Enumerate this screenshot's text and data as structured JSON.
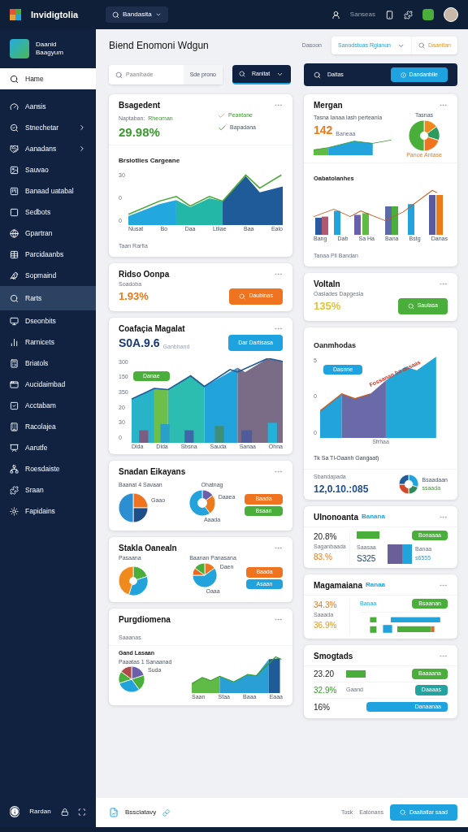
{
  "topbar": {
    "logo_text": "Invidigtolia",
    "search_button": "Bandasita",
    "user_label": "Sanseas"
  },
  "sidebar": {
    "profile": {
      "line1": "Daanid",
      "line2": "Baagyum"
    },
    "items": [
      {
        "label": "Hame",
        "kind": "link",
        "selected": true,
        "highlighted": false
      },
      {
        "label": "Aansis",
        "kind": "link",
        "selected": false,
        "highlighted": false
      },
      {
        "label": "Stnechetar",
        "kind": "group",
        "selected": false,
        "highlighted": false
      },
      {
        "label": "Aanadans",
        "kind": "group",
        "selected": false,
        "highlighted": false
      },
      {
        "label": "Sauvao",
        "kind": "link",
        "selected": false,
        "highlighted": false
      },
      {
        "label": "Banaad uatabal",
        "kind": "link",
        "selected": false,
        "highlighted": false
      },
      {
        "label": "Sedbots",
        "kind": "link",
        "selected": false,
        "highlighted": false
      },
      {
        "label": "Gpartran",
        "kind": "link",
        "selected": false,
        "highlighted": false
      },
      {
        "label": "Parcidaanbs",
        "kind": "link",
        "selected": false,
        "highlighted": false
      },
      {
        "label": "Sopmaind",
        "kind": "link",
        "selected": false,
        "highlighted": false
      },
      {
        "label": "Rarts",
        "kind": "link",
        "selected": false,
        "highlighted": true
      },
      {
        "label": "Dseonbits",
        "kind": "link",
        "selected": false,
        "highlighted": false
      },
      {
        "label": "Rarnicets",
        "kind": "link",
        "selected": false,
        "highlighted": false
      },
      {
        "label": "Briatols",
        "kind": "link",
        "selected": false,
        "highlighted": false
      },
      {
        "label": "Aucidaimbad",
        "kind": "link",
        "selected": false,
        "highlighted": false
      },
      {
        "label": "Acctabam",
        "kind": "link",
        "selected": false,
        "highlighted": false
      },
      {
        "label": "Racolajea",
        "kind": "link",
        "selected": false,
        "highlighted": false
      },
      {
        "label": "Aarutfe",
        "kind": "link",
        "selected": false,
        "highlighted": false
      },
      {
        "label": "Roesdaiste",
        "kind": "link",
        "selected": false,
        "highlighted": false
      },
      {
        "label": "Sraan",
        "kind": "link",
        "selected": false,
        "highlighted": false
      },
      {
        "label": "Fapidains",
        "kind": "link",
        "selected": false,
        "highlighted": false
      }
    ],
    "footer_label": "Rardan"
  },
  "header": {
    "title": "Biend Enomoni Wdgun",
    "filter_label": "Dasoon",
    "select_value": "Sanodstoas Rgianun",
    "action_button": "Daanitan"
  },
  "toolbar": {
    "search_placeholder": "Paanibade",
    "search_button": "Sde prono",
    "dropdown": "Ranitat",
    "panel_label": "Daitas",
    "panel_button": "Dandanbile"
  },
  "cards": {
    "summary": {
      "title": "Bsagedent",
      "label": "Naptaban:",
      "label_value": "Rheoman",
      "value": "29.98%",
      "check_1": "Peantane",
      "check_2": "Bapadana",
      "chart_title": "Brsiotlies Cargeane",
      "yticks": [
        "30",
        "0",
        "0"
      ],
      "xlabels": [
        "Nusat",
        "Bo",
        "Daa",
        "Ltliae",
        "Baa",
        "Ealo"
      ],
      "footer": "Taan Rarfia"
    },
    "margin": {
      "title": "Mergan",
      "caption": "Tasna Ianaa lash perteanla",
      "value": "142",
      "value_note": "Baneaa",
      "pie_label": "Tasnas",
      "pie_note": "Panoe Antase",
      "chart_title": "Oabatolanhes",
      "xlabels": [
        "Bang",
        "Dab",
        "Sa Ha",
        "Bana",
        "Bstg",
        "Danas"
      ],
      "footer": "Tanaa Pll Bandan"
    },
    "ratio": {
      "title": "Ridso Oonpa",
      "caption": "Soadoba",
      "value": "1.93%",
      "button": "Daubinas"
    },
    "volume": {
      "title": "Voltaln",
      "caption": "Oaslades Dapgesia",
      "value": "135%",
      "button": "Saulasa"
    },
    "compare": {
      "title": "Coafaçia Magalat",
      "value": "S0A.9.6",
      "value_note": "Ganbhand",
      "button": "Dar Dartisasa",
      "tag": "Danae",
      "yticks": [
        "300",
        "150",
        "350",
        "20",
        "30",
        "0"
      ],
      "xlabels": [
        "Dlda",
        "Dlda",
        "Sbsna",
        "Sauda",
        "Sanaa",
        "Ohna"
      ]
    },
    "growth": {
      "title": "Oanmhodas",
      "tag": "Dasnne",
      "annotation": "Fossanan ba ansaas",
      "yticks": [
        "5",
        "0",
        "0"
      ],
      "xlabel": "Sfrhaa",
      "footer": "Tk Sa Tl-Oaanh Gangaat)",
      "stat_label": "Sbandapada",
      "stat_value": "12,0.10.:085",
      "donut_label": "Bsaadaan",
      "donut_value": "ssaada"
    },
    "split": {
      "title": "Snadan Eikayans",
      "caption": "Baanat 4 Savaan",
      "pie1_label": "Gaao",
      "pie2_top": "Ohatnag",
      "pie2_label": "Daaea",
      "pie2_bottom": "Aaada",
      "legend": [
        "Baada",
        "Bsaan"
      ]
    },
    "utilization": {
      "title": "Ulnonoanta",
      "badge": "Banana",
      "value_1": "20.8%",
      "tag": "Bonaaaa",
      "caption_1": "Saganbaada",
      "value_2": "83.%",
      "caption_2": "Saasaa",
      "value_3": "S325",
      "block_label": "Banaa",
      "block_value": "s6555"
    },
    "stack": {
      "title": "Stakla Oanealn",
      "caption": "Pasaana",
      "pie2_top": "Baanan Panasana",
      "pie2_label": "Daen",
      "pie2_bottom": "Oaaa",
      "legend": [
        "Baada",
        "Asaan"
      ]
    },
    "magnitude": {
      "title": "Magamaiana",
      "badge": "Ranaa",
      "value_1": "34.3%",
      "label": "Banaa",
      "tag": "Bsaanan",
      "caption": "Saaada",
      "value_2": "36.9%"
    },
    "progress": {
      "title": "Purgdiomena",
      "caption": "Saaanas",
      "chart_title": "Gand Lasaan",
      "chart_caption": "Paaatas 1 Sanaanad",
      "pie_label": "Suda",
      "xlabels": [
        "Saan",
        "Staa",
        "Baaa",
        "Eaaa"
      ]
    },
    "snapshot": {
      "title": "Smogtads",
      "rows": [
        {
          "value": "23.20",
          "label": "",
          "tag": "Baaaana"
        },
        {
          "value": "32.9%",
          "label": "Gaand",
          "tag": "Daaaas"
        },
        {
          "value": "16%",
          "label": "",
          "tag": "Danaanaa"
        }
      ]
    }
  },
  "footer": {
    "label": "Bssclatavy",
    "link_1": "Tosk",
    "link_2": "Eatonans",
    "button": "Daaitatlar saad"
  }
}
